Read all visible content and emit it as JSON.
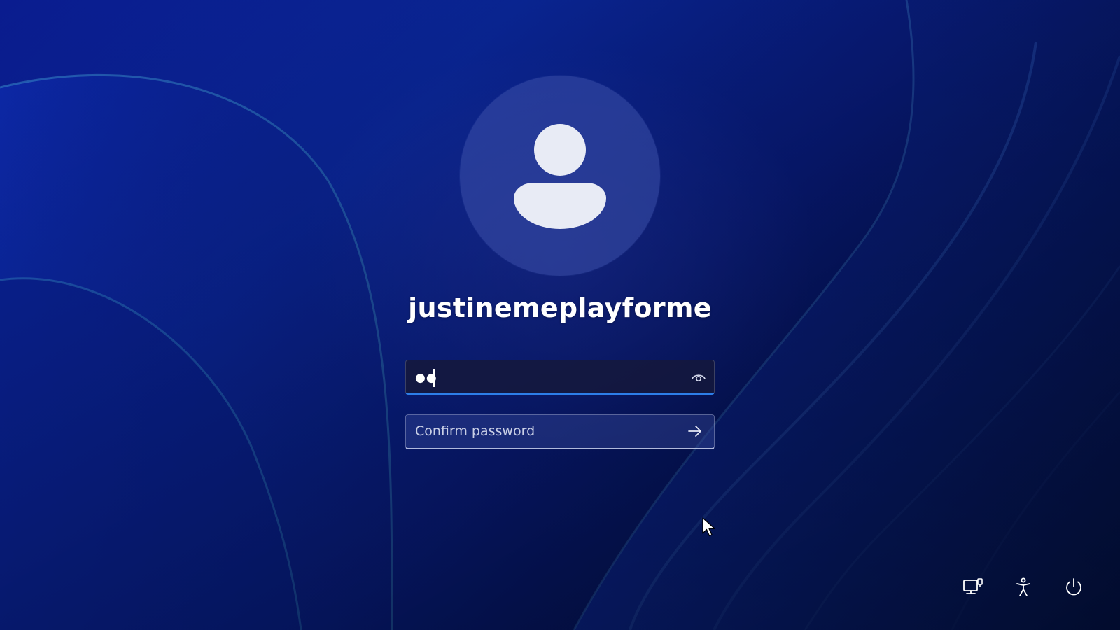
{
  "user": {
    "name": "justinemeplayforme"
  },
  "password_field": {
    "masked_value": "●●",
    "reveal_icon": "eye-icon"
  },
  "confirm_field": {
    "placeholder": "Confirm password",
    "submit_icon": "arrow-right-icon"
  },
  "corner_buttons": [
    {
      "icon": "network-icon"
    },
    {
      "icon": "accessibility-icon"
    },
    {
      "icon": "power-icon"
    }
  ],
  "colors": {
    "background": "#0b2aa8",
    "accent": "#2d7ee8",
    "text": "#ffffff"
  }
}
